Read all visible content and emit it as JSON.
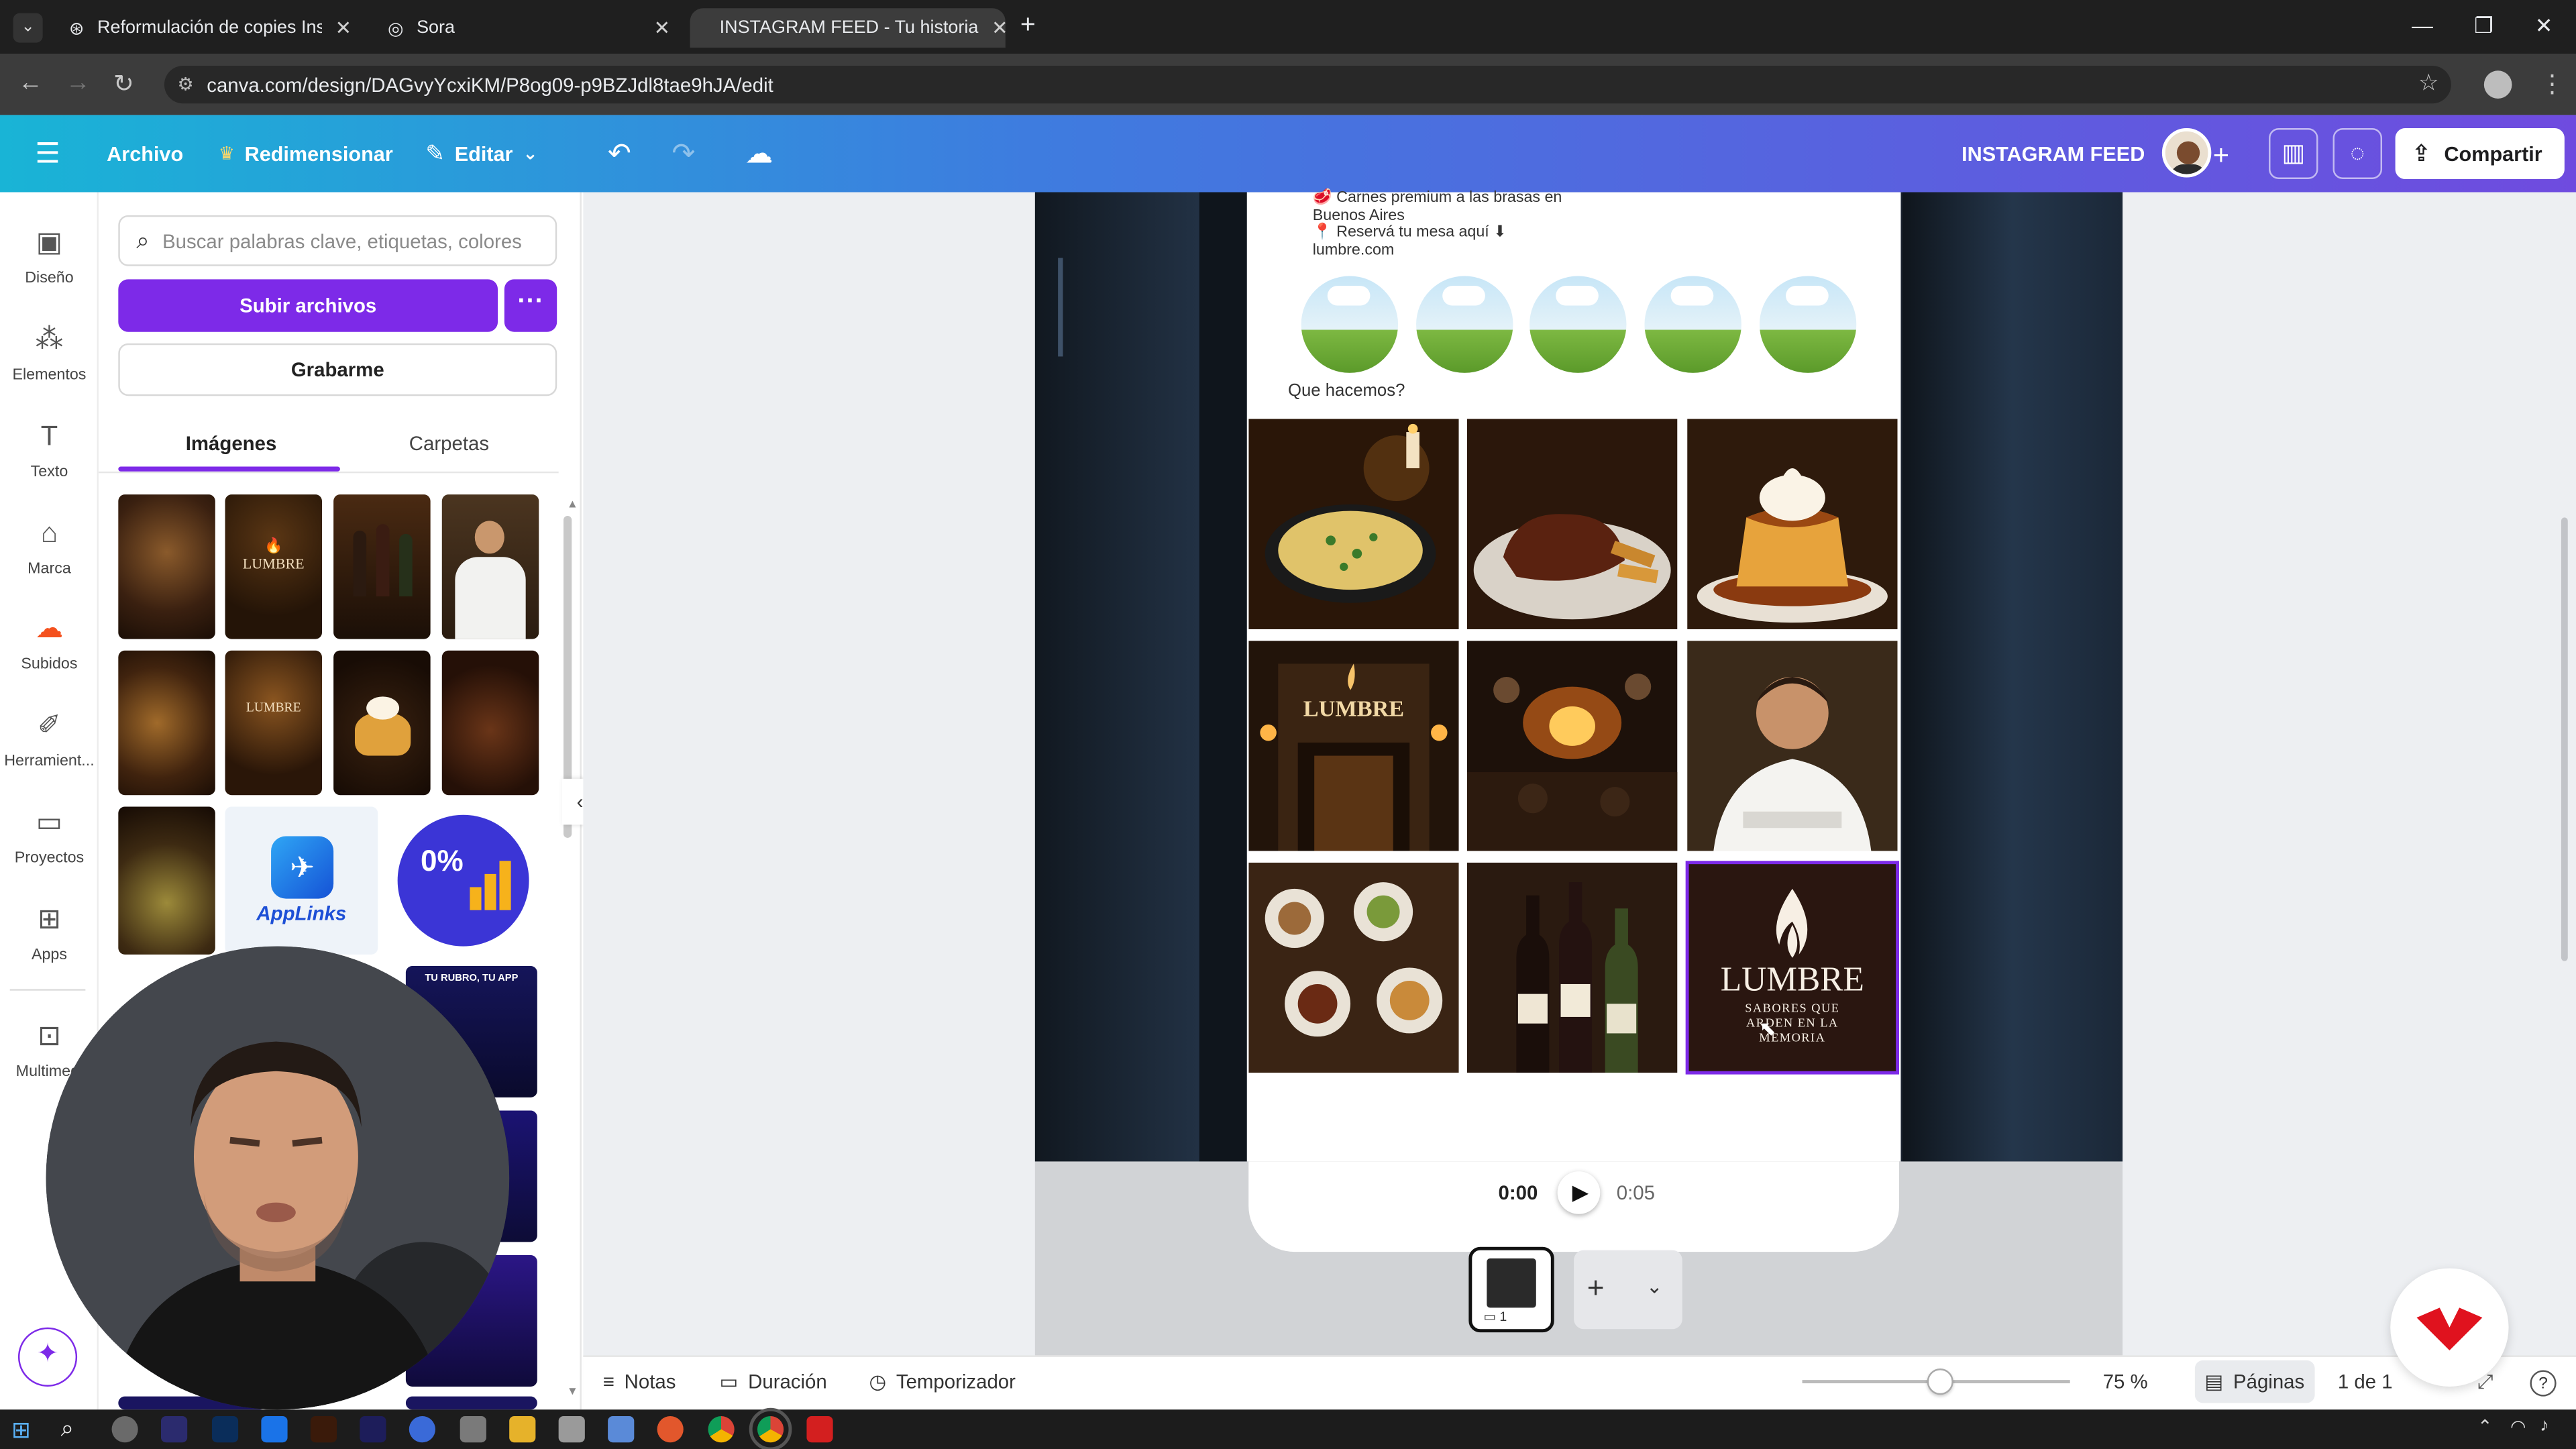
{
  "browser": {
    "tabs": [
      {
        "title": "Reformulación de copies Instag",
        "icon": "chatgpt-icon"
      },
      {
        "title": "Sora",
        "icon": "sora-icon"
      },
      {
        "title": "INSTAGRAM FEED - Tu historia",
        "icon": "canva-icon",
        "active": true
      }
    ],
    "url": "canva.com/design/DAGvyYcxiKM/P8og09-p9BZJdl8tae9hJA/edit"
  },
  "toolbar": {
    "archivo": "Archivo",
    "redimensionar": "Redimensionar",
    "editar": "Editar",
    "design_title": "INSTAGRAM FEED",
    "share": "Compartir"
  },
  "rail": [
    {
      "label": "Diseño",
      "icon": "layout-icon"
    },
    {
      "label": "Elementos",
      "icon": "shapes-icon"
    },
    {
      "label": "Texto",
      "icon": "text-icon"
    },
    {
      "label": "Marca",
      "icon": "brand-icon"
    },
    {
      "label": "Subidos",
      "icon": "upload-cloud-icon"
    },
    {
      "label": "Herramient...",
      "icon": "draw-icon"
    },
    {
      "label": "Proyectos",
      "icon": "folder-icon"
    },
    {
      "label": "Apps",
      "icon": "apps-icon"
    },
    {
      "label": "Multimedi",
      "icon": "media-icon"
    }
  ],
  "panel": {
    "search_placeholder": "Buscar palabras clave, etiquetas, colores",
    "upload": "Subir archivos",
    "record": "Grabarme",
    "tabs": [
      "Imágenes",
      "Carpetas"
    ],
    "applinks": "AppLinks"
  },
  "canvas": {
    "bio": [
      "🥩 Carnes premium a las brasas en",
      "Buenos Aires",
      "📍 Reservá tu mesa aquí ⬇",
      "lumbre.com"
    ],
    "highlights_title": "Que hacemos?",
    "grid_logo": {
      "name": "LUMBRE",
      "tagline": "SABORES QUE ARDEN EN LA MEMORIA"
    },
    "sign_text": "LUMBRE"
  },
  "player": {
    "current": "0:00",
    "total": "0:05"
  },
  "bottom": {
    "notes": "Notas",
    "duration": "Duración",
    "timer": "Temporizador",
    "zoom": "75 %",
    "pages": "Páginas",
    "page_count": "1 de 1"
  },
  "colors": {
    "canva_purple": "#7d2ae8",
    "toolbar_start": "#19b4d6",
    "toolbar_end": "#6f4bdf"
  }
}
